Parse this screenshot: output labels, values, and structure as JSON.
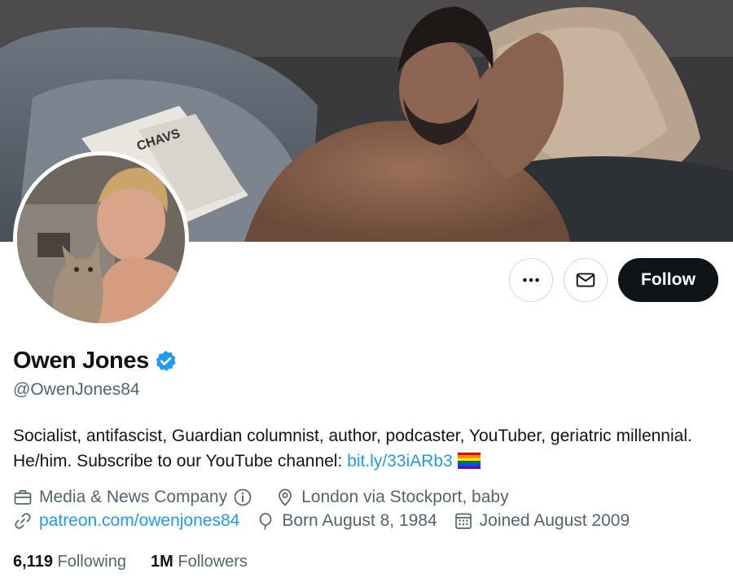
{
  "profile": {
    "display_name": "Owen Jones",
    "handle": "@OwenJones84",
    "bio_text": "Socialist, antifascist, Guardian columnist, author, podcaster, YouTuber, geriatric millennial. He/him. Subscribe to our YouTube channel: ",
    "bio_link": "bit.ly/33iARb3",
    "banner_book_text": "CHAVS"
  },
  "actions": {
    "more_icon": "ellipsis-icon",
    "message_icon": "envelope-icon",
    "follow_label": "Follow"
  },
  "meta": {
    "category": "Media & News Company",
    "location": "London via Stockport, baby",
    "website": "patreon.com/owenjones84",
    "birthday": "Born August 8, 1984",
    "joined": "Joined August 2009"
  },
  "stats": {
    "following_count": "6,119",
    "following_label": "Following",
    "followers_count": "1M",
    "followers_label": "Followers"
  },
  "colors": {
    "accent": "#1d9bf0",
    "text_primary": "#0f1419",
    "text_secondary": "#536471",
    "follow_button": "#0f1419",
    "pride_flag": [
      "#e40303",
      "#ff8c00",
      "#ffed00",
      "#008026",
      "#004dff",
      "#750787"
    ]
  }
}
